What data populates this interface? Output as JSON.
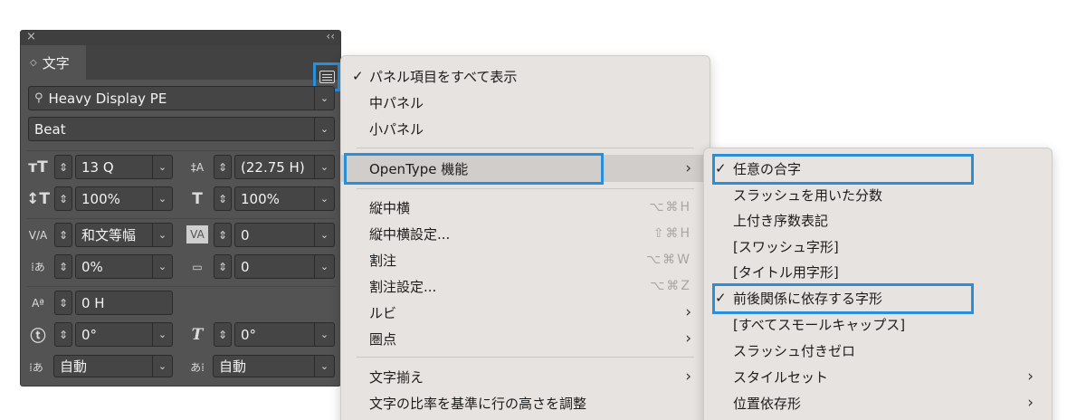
{
  "panel": {
    "tab_label": "文字",
    "font_family": "Heavy Display PE",
    "font_style": "Beat",
    "size": "13 Q",
    "leading": "(22.75 H)",
    "vertical_scale": "100%",
    "horizontal_scale": "100%",
    "kerning": "和文等幅",
    "tracking": "0",
    "tsume": "0%",
    "aki": "0",
    "baseline_shift": "0 H",
    "rotation": "0°",
    "skew": "0°",
    "aki_before": "自動",
    "aki_after": "自動"
  },
  "menu": {
    "items": [
      {
        "label": "パネル項目をすべて表示",
        "checked": true
      },
      {
        "label": "中パネル"
      },
      {
        "label": "小パネル"
      },
      {
        "label": "OpenType 機能",
        "submenu": true,
        "highlighted": true
      },
      {
        "label": "縦中横",
        "shortcut": "⌥⌘H"
      },
      {
        "label": "縦中横設定...",
        "shortcut": "⇧⌘H"
      },
      {
        "label": "割注",
        "shortcut": "⌥⌘W"
      },
      {
        "label": "割注設定...",
        "shortcut": "⌥⌘Z"
      },
      {
        "label": "ルビ",
        "submenu": true
      },
      {
        "label": "圏点",
        "submenu": true
      },
      {
        "label": "文字揃え",
        "submenu": true
      },
      {
        "label": "文字の比率を基準に行の高さを調整"
      }
    ]
  },
  "submenu": {
    "items": [
      {
        "label": "任意の合字",
        "checked": true
      },
      {
        "label": "スラッシュを用いた分数"
      },
      {
        "label": "上付き序数表記"
      },
      {
        "label": "[スワッシュ字形]"
      },
      {
        "label": "[タイトル用字形]"
      },
      {
        "label": "前後関係に依存する字形",
        "checked": true
      },
      {
        "label": "[すべてスモールキャップス]"
      },
      {
        "label": "スラッシュ付きゼロ"
      },
      {
        "label": "スタイルセット",
        "submenu": true
      },
      {
        "label": "位置依存形",
        "submenu": true
      }
    ]
  },
  "glyphs": {
    "check": "✓",
    "arrow": "›",
    "dropdown": "⌄",
    "stepper": "⌃⌄",
    "close": "×",
    "collapse": "‹‹"
  },
  "colors": {
    "highlight_box": "#2a8fd6",
    "panel_bg": "#535353",
    "menu_bg": "#e7e3e0"
  }
}
